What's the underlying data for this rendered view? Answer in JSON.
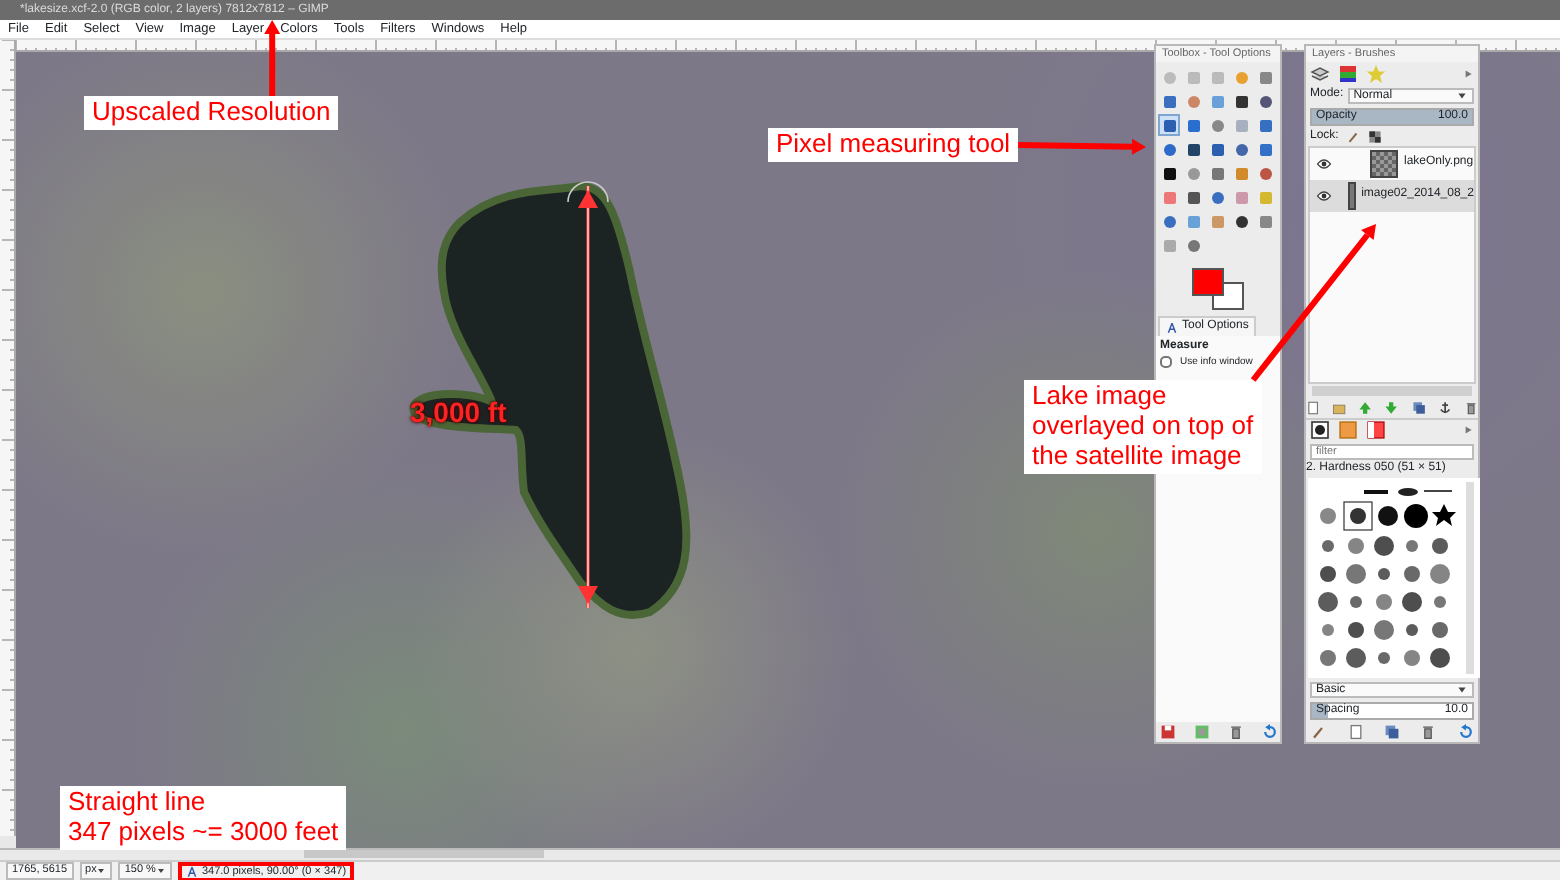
{
  "window": {
    "title": "*lakesize.xcf-2.0 (RGB color, 2 layers) 7812x7812 – GIMP"
  },
  "menu": [
    "File",
    "Edit",
    "Select",
    "View",
    "Image",
    "Layer",
    "Colors",
    "Tools",
    "Filters",
    "Windows",
    "Help"
  ],
  "toolbox": {
    "title": "Toolbox - Tool Options",
    "tools": [
      {
        "selected": false
      },
      {
        "selected": false
      },
      {
        "selected": false
      },
      {
        "selected": false
      },
      {
        "selected": false
      },
      {
        "selected": false
      },
      {
        "selected": false
      },
      {
        "selected": false
      },
      {
        "selected": false
      },
      {
        "selected": false
      },
      {
        "selected": true
      },
      {
        "selected": false
      },
      {
        "selected": false
      },
      {
        "selected": false
      },
      {
        "selected": false
      },
      {
        "selected": false
      },
      {
        "selected": false
      },
      {
        "selected": false
      },
      {
        "selected": false
      },
      {
        "selected": false
      },
      {
        "selected": false
      },
      {
        "selected": false
      },
      {
        "selected": false
      },
      {
        "selected": false
      },
      {
        "selected": false
      },
      {
        "selected": false
      },
      {
        "selected": false
      },
      {
        "selected": false
      },
      {
        "selected": false
      },
      {
        "selected": false
      },
      {
        "selected": false
      },
      {
        "selected": false
      },
      {
        "selected": false
      },
      {
        "selected": false
      },
      {
        "selected": false
      },
      {
        "selected": false
      },
      {
        "selected": false
      }
    ],
    "options_tab": "Tool Options",
    "tool_name": "Measure",
    "use_info_window": {
      "label": "Use info window",
      "checked": false
    }
  },
  "layers_dock": {
    "title": "Layers - Brushes",
    "mode_label": "Mode:",
    "mode": "Normal",
    "opacity": {
      "label": "Opacity",
      "value": "100.0",
      "level": 1
    },
    "lock_label": "Lock:",
    "layers": [
      {
        "name": "lakeOnly.png",
        "visible": true,
        "selected": false
      },
      {
        "name": "image02_2014_08_2",
        "visible": true,
        "selected": true
      }
    ],
    "brush_filter_placeholder": "filter",
    "brush_name": "2. Hardness 050 (51 × 51)",
    "brush_set": "Basic",
    "spacing": {
      "label": "Spacing",
      "value": "10.0",
      "level": 0.1
    }
  },
  "canvas": {
    "measure_label": "3,000 ft"
  },
  "annotations": [
    {
      "text": "Upscaled Resolution"
    },
    {
      "text": "Pixel measuring tool"
    },
    {
      "text": "Lake image\noverlayed on top of\nthe satellite image"
    },
    {
      "text": "Straight line\n347 pixels ~= 3000 feet"
    }
  ],
  "status_bar": {
    "coordinates": "1765, 5615",
    "unit": "px",
    "zoom": "150 %",
    "message": "347.0 pixels, 90.00° (0 × 347)",
    "highlighted": true
  }
}
